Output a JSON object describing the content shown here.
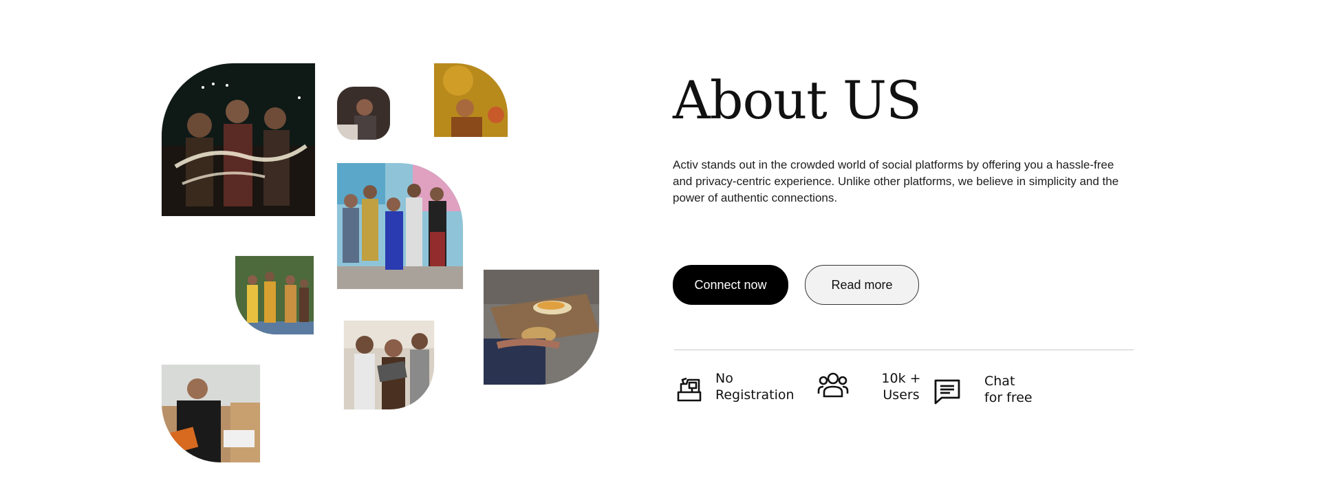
{
  "about": {
    "title": "About US",
    "description": "Activ stands out in the crowded world of social platforms by offering you a hassle-free and privacy-centric experience. Unlike other platforms, we believe in simplicity and the power of authentic connections."
  },
  "buttons": {
    "connect": "Connect now",
    "read_more": "Read more"
  },
  "features": [
    {
      "icon": "cash-register-icon",
      "line1": "No",
      "line2": "Registration"
    },
    {
      "icon": "users-group-icon",
      "line1": "10k +",
      "line2": "Users"
    },
    {
      "icon": "chat-icon",
      "line1": "Chat",
      "line2": "for free"
    }
  ],
  "colors": {
    "primary_button": "#000000",
    "secondary_button": "#f2f2f2",
    "divider": "#c9c9c9"
  }
}
